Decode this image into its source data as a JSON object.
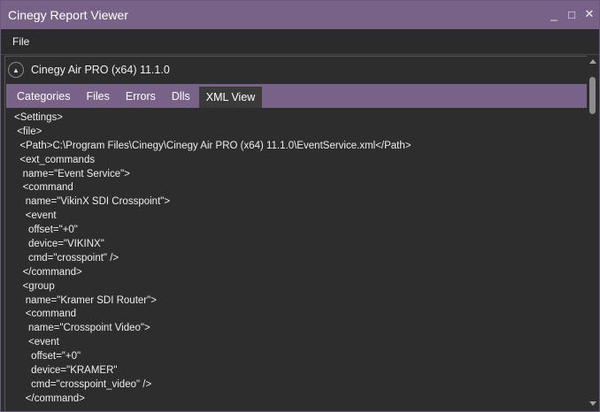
{
  "window": {
    "title": "Cinegy Report Viewer",
    "controls": {
      "minimize": "_",
      "maximize": "□",
      "close": "✕"
    }
  },
  "menu": {
    "items": [
      {
        "label": "File"
      }
    ]
  },
  "group": {
    "expander_glyph": "▲",
    "title": "Cinegy Air PRO (x64) 11.1.0"
  },
  "tabs": [
    {
      "label": "Categories",
      "active": false
    },
    {
      "label": "Files",
      "active": false
    },
    {
      "label": "Errors",
      "active": false
    },
    {
      "label": "Dlls",
      "active": false
    },
    {
      "label": "XML View",
      "active": true
    }
  ],
  "xml_view": {
    "lines": [
      "<Settings>",
      " <file>",
      "  <Path>C:\\Program Files\\Cinegy\\Cinegy Air PRO (x64) 11.1.0\\EventService.xml</Path>",
      "  <ext_commands",
      "   name=\"Event Service\">",
      "   <command",
      "    name=\"VikinX SDI Crosspoint\">",
      "    <event",
      "     offset=\"+0\"",
      "     device=\"VIKINX\"",
      "     cmd=\"crosspoint\" />",
      "   </command>",
      "   <group",
      "    name=\"Kramer SDI Router\">",
      "    <command",
      "     name=\"Crosspoint Video\">",
      "     <event",
      "      offset=\"+0\"",
      "      device=\"KRAMER\"",
      "      cmd=\"crosspoint_video\" />",
      "    </command>"
    ]
  },
  "colors": {
    "accent": "#786287",
    "background": "#2d2d2d",
    "text": "#eeeeee"
  }
}
